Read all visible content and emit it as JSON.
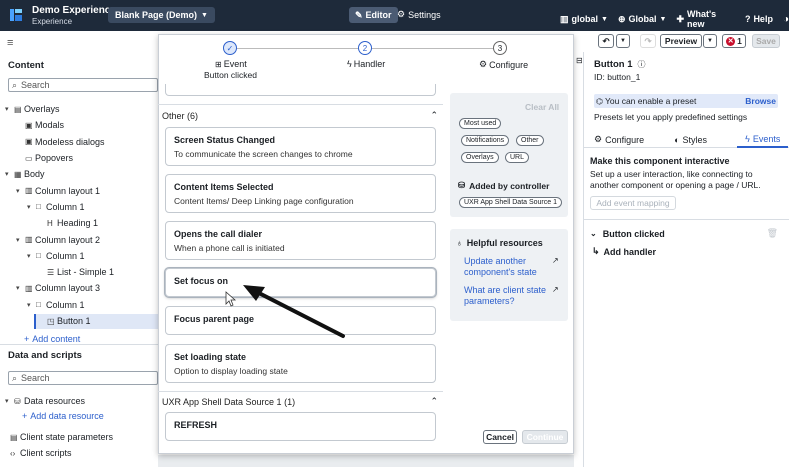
{
  "topbar": {
    "app_title": "Demo Experience",
    "app_subtitle": "Experience",
    "page_selector": "Blank Page (Demo)",
    "editor_label": "Editor",
    "settings_label": "Settings",
    "global_scope": "global",
    "global_menu": "Global",
    "whats_new": "What's new",
    "help": "Help"
  },
  "toolbar": {
    "preview": "Preview",
    "error_count": "1",
    "save": "Save"
  },
  "left": {
    "content_heading": "Content",
    "search_placeholder": "Search",
    "tree": [
      {
        "label": "Overlays",
        "indent": 0,
        "caret": "▾",
        "icon": "▤"
      },
      {
        "label": "Modals",
        "indent": 1,
        "caret": "",
        "icon": "▣"
      },
      {
        "label": "Modeless dialogs",
        "indent": 1,
        "caret": "",
        "icon": "▣"
      },
      {
        "label": "Popovers",
        "indent": 1,
        "caret": "",
        "icon": "▭"
      },
      {
        "label": "Body",
        "indent": 0,
        "caret": "▾",
        "icon": "▦"
      },
      {
        "label": "Column layout 1",
        "indent": 1,
        "caret": "▾",
        "icon": "▥"
      },
      {
        "label": "Column 1",
        "indent": 2,
        "caret": "▾",
        "icon": "□"
      },
      {
        "label": "Heading 1",
        "indent": 3,
        "caret": "",
        "icon": "H"
      },
      {
        "label": "Column layout 2",
        "indent": 1,
        "caret": "▾",
        "icon": "▥"
      },
      {
        "label": "Column 1",
        "indent": 2,
        "caret": "▾",
        "icon": "□"
      },
      {
        "label": "List - Simple 1",
        "indent": 3,
        "caret": "",
        "icon": "☰"
      },
      {
        "label": "Column layout 3",
        "indent": 1,
        "caret": "▾",
        "icon": "▥"
      },
      {
        "label": "Column 1",
        "indent": 2,
        "caret": "▾",
        "icon": "□"
      },
      {
        "label": "Button 1",
        "indent": 3,
        "caret": "",
        "icon": "◳"
      }
    ],
    "add_content": "Add content",
    "data_heading": "Data and scripts",
    "data_search_placeholder": "Search",
    "data_resources": "Data resources",
    "add_data_resource": "Add data resource",
    "client_state": "Client state parameters",
    "client_scripts": "Client scripts"
  },
  "modal": {
    "steps": [
      {
        "num": "✓",
        "label": "Event",
        "sub": "Button clicked"
      },
      {
        "num": "2",
        "label": "Handler",
        "sub": ""
      },
      {
        "num": "3",
        "label": "Configure",
        "sub": ""
      }
    ],
    "group_other": "Other (6)",
    "cards": [
      {
        "title": "Screen Status Changed",
        "sub": "To communicate the screen changes to chrome"
      },
      {
        "title": "Content Items Selected",
        "sub": "Content Items/ Deep Linking page configuration"
      },
      {
        "title": "Opens the call dialer",
        "sub": "When a phone call is initiated"
      },
      {
        "title": "Set focus on",
        "sub": ""
      },
      {
        "title": "Focus parent page",
        "sub": ""
      },
      {
        "title": "Set loading state",
        "sub": "Option to display loading state"
      }
    ],
    "group_uxr": "UXR App Shell Data Source 1 (1)",
    "uxr_card": "REFRESH",
    "filters": {
      "clear_all": "Clear All",
      "chips_row1": [
        "Most used"
      ],
      "chips_row2": [
        "Notifications",
        "Other"
      ],
      "chips_row3": [
        "Overlays",
        "URL"
      ],
      "added_by": "Added by controller",
      "controller_chip": "UXR App Shell Data Source 1"
    },
    "helpful": {
      "title": "Helpful resources",
      "link1": "Update another component's state",
      "link2": "What are client state parameters?"
    },
    "cancel": "Cancel",
    "continue": "Continue"
  },
  "right": {
    "component_title": "Button 1",
    "component_id": "ID: button_1",
    "preset_note": "You can enable a preset",
    "browse": "Browse",
    "preset_desc": "Presets let you apply predefined settings",
    "tabs": [
      "Configure",
      "Styles",
      "Events"
    ],
    "make_interactive": "Make this component interactive",
    "interactive_desc": "Set up a user interaction, like connecting to another component or opening a page / URL.",
    "add_event_mapping": "Add event mapping",
    "button_clicked": "Button clicked",
    "add_handler": "Add handler"
  },
  "colors": {
    "topbar": "#1e2a3a",
    "accent": "#2c5fcc",
    "error": "#c8102e"
  }
}
